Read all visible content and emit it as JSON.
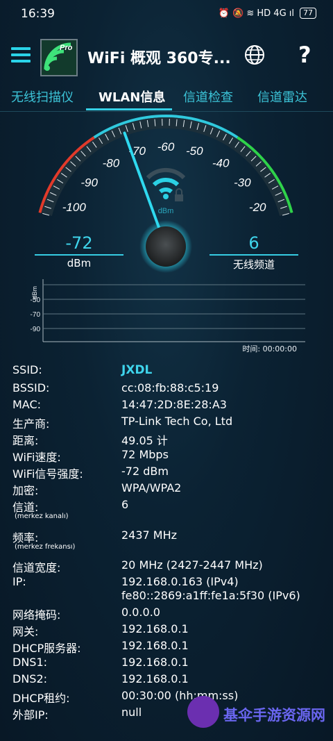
{
  "status_bar": {
    "time": "16:39",
    "indicators": "⏰ 🔕 ≋ HD 4G ıl",
    "battery": "77"
  },
  "app_bar": {
    "title": "WiFi 概观 360专...",
    "logo_badge": "Pro"
  },
  "tabs": [
    {
      "label": "无线扫描仪"
    },
    {
      "label": "WLAN信息",
      "active": true
    },
    {
      "label": "信道检查"
    },
    {
      "label": "信道雷达"
    }
  ],
  "gauge": {
    "scale_labels": [
      "-100",
      "-90",
      "-80",
      "-70",
      "-60",
      "-50",
      "-40",
      "-30",
      "-20"
    ],
    "unit": "dBm",
    "needle_value": -72,
    "signal_readout": {
      "value": "-72",
      "label": "dBm"
    },
    "channel_readout": {
      "value": "6",
      "label": "无线频道"
    },
    "colors": {
      "low": "#e23a2a",
      "mid": "#30c9dd",
      "high": "#2fd24a"
    }
  },
  "graph": {
    "ylabel": "dBm",
    "ticks": [
      "-50",
      "-70",
      "-90"
    ],
    "time_label": "时间: 00:00:00"
  },
  "info": [
    {
      "key": "SSID:",
      "value": "JXDL"
    },
    {
      "key": "BSSID:",
      "value": "cc:08:fb:88:c5:19"
    },
    {
      "key": "MAC:",
      "value": "14:47:2D:8E:28:A3"
    },
    {
      "key": "生产商:",
      "value": "TP-Link Tech Co, Ltd"
    },
    {
      "key": "距离:",
      "value": "49.05 计"
    },
    {
      "key": "WiFi速度:",
      "value": "72 Mbps"
    },
    {
      "key": "WiFi信号强度:",
      "value": "-72 dBm"
    },
    {
      "key": "加密:",
      "value": "WPA/WPA2"
    },
    {
      "key": "信道:",
      "value": "6",
      "sub": "(merkez kanalı)"
    },
    {
      "key": "频率:",
      "value": "2437 MHz",
      "sub": "(merkez frekansı)"
    },
    {
      "key": "信道宽度:",
      "value": "20 MHz (2427-2447 MHz)"
    },
    {
      "key": "IP:",
      "value": "192.168.0.163 (IPv4)",
      "value2": "fe80::2869:a1ff:fe1a:5f30 (IPv6)"
    },
    {
      "key": "网络掩码:",
      "value": "0.0.0.0"
    },
    {
      "key": "网关:",
      "value": "192.168.0.1"
    },
    {
      "key": "DHCP服务器:",
      "value": "192.168.0.1"
    },
    {
      "key": "DNS1:",
      "value": "192.168.0.1"
    },
    {
      "key": "DNS2:",
      "value": "192.168.0.1"
    },
    {
      "key": "DHCP租约:",
      "value": "00:30:00 (hh:mm:ss)"
    },
    {
      "key": "外部IP:",
      "value": "null"
    }
  ],
  "watermark": {
    "text": "基伞手游资源网"
  }
}
